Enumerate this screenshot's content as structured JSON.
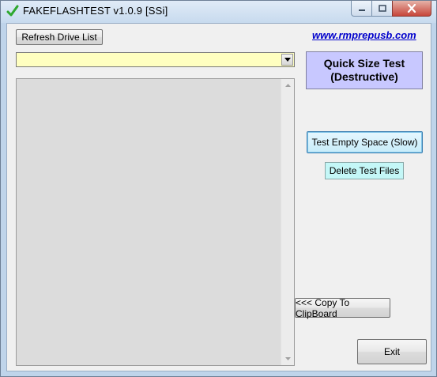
{
  "window": {
    "title": "FAKEFLASHTEST v1.0.9  [SSi]",
    "title_icon": "check-icon",
    "title_icon_color": "#2ea82e"
  },
  "toolbar": {
    "refresh_label": "Refresh Drive List"
  },
  "link": {
    "text": "www.rmprepusb.com",
    "color": "#0000cc"
  },
  "drive_select": {
    "value": "",
    "background": "#ffffc0"
  },
  "output": {
    "text": ""
  },
  "actions": {
    "quick_line1": "Quick Size Test",
    "quick_line2": "(Destructive)",
    "quick_color": "#c8c8ff",
    "test_empty_label": "Test Empty Space (Slow)",
    "delete_label": "Delete Test Files",
    "delete_color": "#c4f7f7",
    "copy_label": "<<< Copy To ClipBoard",
    "exit_label": "Exit"
  }
}
